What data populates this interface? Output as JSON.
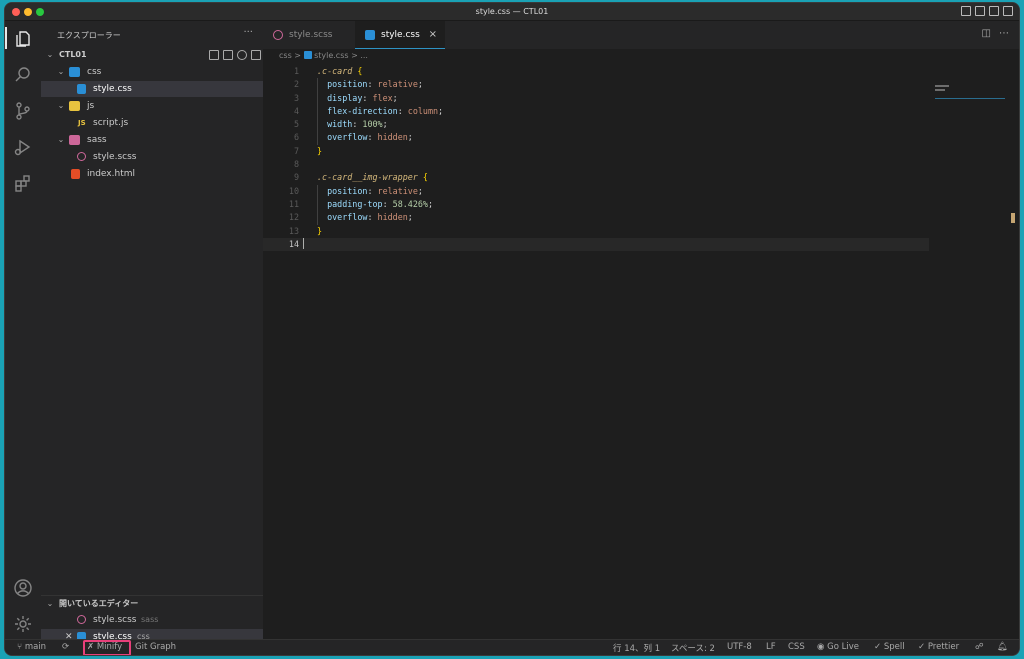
{
  "window": {
    "title": "style.css — CTL01"
  },
  "sidebar": {
    "title": "エクスプローラー",
    "more": "···",
    "root": "CTL01",
    "tree": [
      {
        "label": "css",
        "kind": "folder"
      },
      {
        "label": "style.css",
        "kind": "file"
      },
      {
        "label": "js",
        "kind": "folder"
      },
      {
        "label": "script.js",
        "kind": "file"
      },
      {
        "label": "sass",
        "kind": "folder"
      },
      {
        "label": "style.scss",
        "kind": "file"
      },
      {
        "label": "index.html",
        "kind": "file"
      }
    ],
    "js_icon_text": "JS",
    "open_editors": {
      "title": "開いているエディター",
      "items": [
        {
          "label": "style.scss",
          "folder": "sass"
        },
        {
          "label": "style.css",
          "folder": "css"
        }
      ]
    }
  },
  "tabs": [
    {
      "label": "style.scss"
    },
    {
      "label": "style.css",
      "close": "×"
    }
  ],
  "breadcrumb": {
    "folder": "css",
    "sep": ">",
    "file": "style.css",
    "rest": "> ..."
  },
  "editor": {
    "line_numbers": [
      "1",
      "2",
      "3",
      "4",
      "5",
      "6",
      "7",
      "8",
      "9",
      "10",
      "11",
      "12",
      "13",
      "14"
    ],
    "code": {
      "l1_sel": ".c-card",
      "l1_brace": " {",
      "l2_prop": "position",
      "l2_val": "relative",
      "l3_prop": "display",
      "l3_val": "flex",
      "l4_prop": "flex-direction",
      "l4_val": "column",
      "l5_prop": "width",
      "l5_val": "100%",
      "l6_prop": "overflow",
      "l6_val": "hidden",
      "l7": "}",
      "l9_sel": ".c-card__img-wrapper",
      "l9_brace": " {",
      "l10_prop": "position",
      "l10_val": "relative",
      "l11_prop": "padding-top",
      "l11_val": "58.426%",
      "l12_prop": "overflow",
      "l12_val": "hidden",
      "l13": "}"
    },
    "minimap_label": "概_c-\n.wra"
  },
  "statusbar": {
    "branch": "main",
    "minify": "Minify",
    "git_graph": "Git Graph",
    "position": "行 14、列 1",
    "spaces": "スペース: 2",
    "encoding": "UTF-8",
    "eol": "LF",
    "language": "CSS",
    "golive": "Go Live",
    "spell": "Spell",
    "prettier": "Prettier"
  },
  "colors": {
    "accent": "#2e93c4",
    "highlight_box": "#e8407a",
    "css_icon": "#2a8fd6",
    "js_icon": "#e8c33f",
    "sass_icon": "#cd6799",
    "html_icon": "#e44d26"
  }
}
